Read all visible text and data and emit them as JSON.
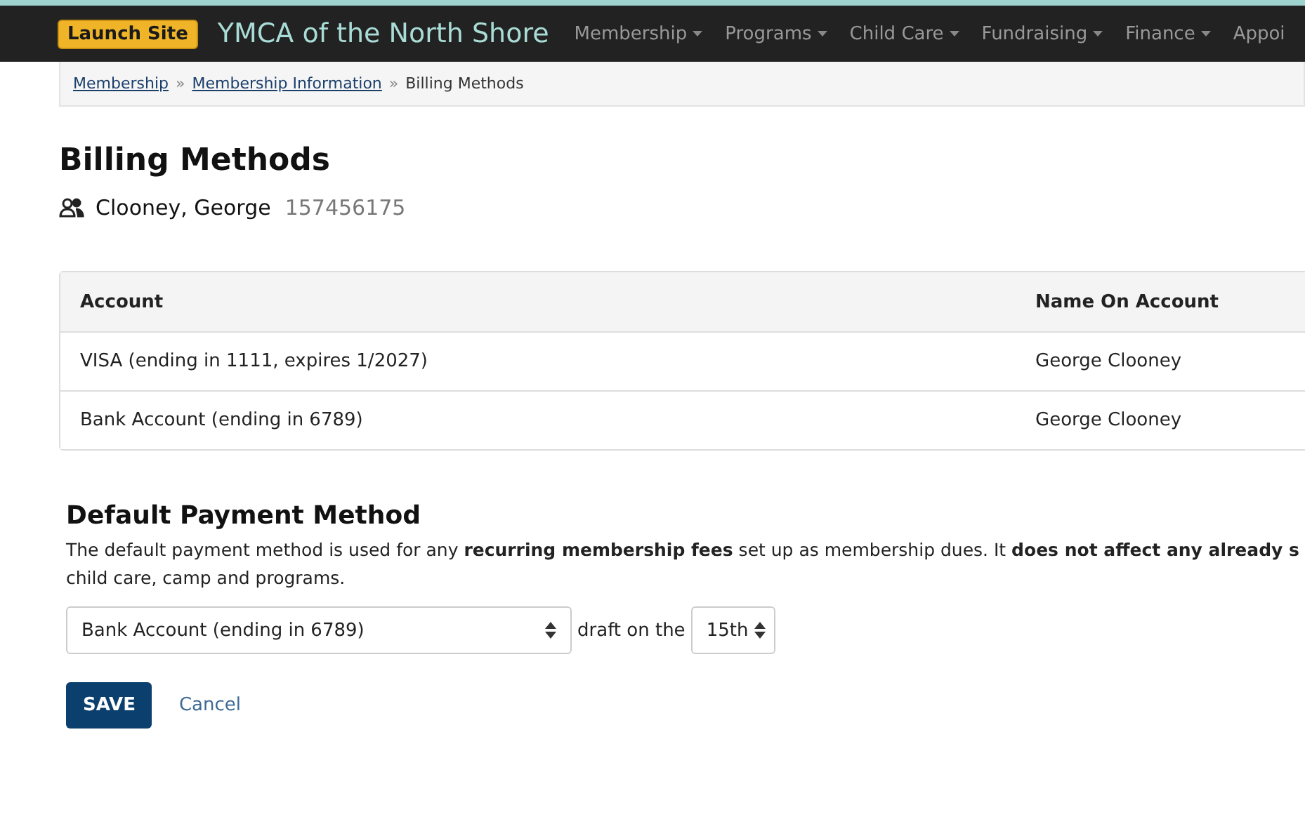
{
  "navbar": {
    "launch_button": "Launch Site",
    "brand": "YMCA of the North Shore",
    "menu": [
      {
        "label": "Membership",
        "has_caret": true
      },
      {
        "label": "Programs",
        "has_caret": true
      },
      {
        "label": "Child Care",
        "has_caret": true
      },
      {
        "label": "Fundraising",
        "has_caret": true
      },
      {
        "label": "Finance",
        "has_caret": true
      },
      {
        "label": "Appoi",
        "has_caret": false
      }
    ]
  },
  "breadcrumb": {
    "links": [
      "Membership",
      "Membership Information"
    ],
    "separator": "»",
    "current": "Billing Methods"
  },
  "page_title": "Billing Methods",
  "member": {
    "name": "Clooney, George",
    "id": "157456175"
  },
  "table": {
    "columns": [
      "Account",
      "Name On Account"
    ],
    "rows": [
      [
        "VISA (ending in 1111, expires 1/2027)",
        "George Clooney"
      ],
      [
        "Bank Account (ending in 6789)",
        "George Clooney"
      ]
    ]
  },
  "default_payment": {
    "title": "Default Payment Method",
    "description": [
      "The default payment method is used for any **recurring membership fees** set up as membership dues. It **does not affect any already s**",
      "child care, camp and programs."
    ],
    "method_select": "Bank Account (ending in 6789)",
    "draft_label": "draft on the",
    "day_select": "15th"
  },
  "buttons": {
    "save": "SAVE",
    "cancel": "Cancel"
  }
}
